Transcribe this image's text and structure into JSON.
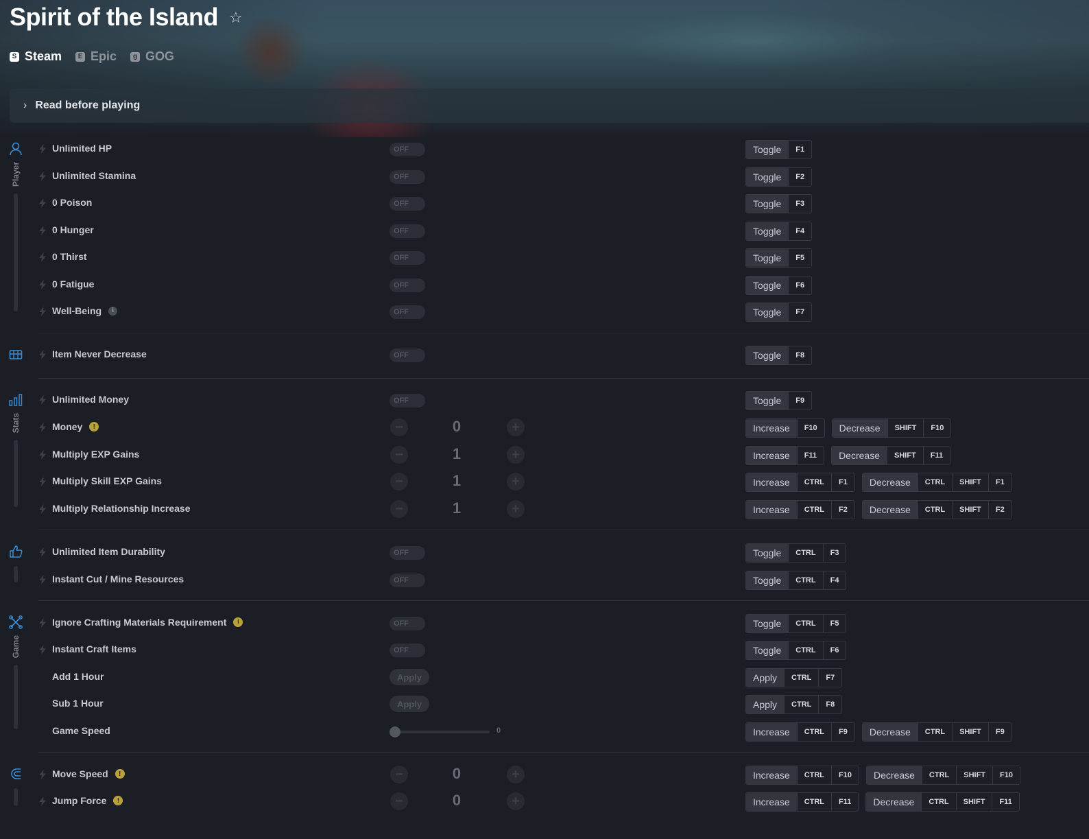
{
  "game": {
    "title": "Spirit of the Island"
  },
  "platforms": [
    {
      "label": "Steam",
      "icon": "steam-icon",
      "glyph": "S",
      "active": true
    },
    {
      "label": "Epic",
      "icon": "epic-icon",
      "glyph": "E",
      "active": false
    },
    {
      "label": "GOG",
      "icon": "gog-icon",
      "glyph": "g",
      "active": false
    }
  ],
  "notice": {
    "label": "Read before playing"
  },
  "categories": {
    "player": {
      "label": "Player",
      "icon": "person-icon"
    },
    "inventory": {
      "label": "",
      "icon": "chest-icon"
    },
    "stats": {
      "label": "Stats",
      "icon": "bar-chart-icon"
    },
    "tools": {
      "label": "",
      "icon": "thumbs-up-icon"
    },
    "game": {
      "label": "Game",
      "icon": "crossed-tools-icon"
    },
    "movement": {
      "label": "",
      "icon": "magnet-icon"
    }
  },
  "labels": {
    "off": "OFF",
    "apply": "Apply",
    "toggle": "Toggle",
    "increase": "Increase",
    "decrease": "Decrease"
  },
  "cheats": [
    {
      "name": "Unlimited HP",
      "control": "toggle",
      "state": "OFF",
      "hotkeys": [
        {
          "action": "Toggle",
          "keys": [
            "F1"
          ]
        }
      ]
    },
    {
      "name": "Unlimited Stamina",
      "control": "toggle",
      "state": "OFF",
      "hotkeys": [
        {
          "action": "Toggle",
          "keys": [
            "F2"
          ]
        }
      ]
    },
    {
      "name": "0 Poison",
      "control": "toggle",
      "state": "OFF",
      "hotkeys": [
        {
          "action": "Toggle",
          "keys": [
            "F3"
          ]
        }
      ]
    },
    {
      "name": "0 Hunger",
      "control": "toggle",
      "state": "OFF",
      "hotkeys": [
        {
          "action": "Toggle",
          "keys": [
            "F4"
          ]
        }
      ]
    },
    {
      "name": "0 Thirst",
      "control": "toggle",
      "state": "OFF",
      "hotkeys": [
        {
          "action": "Toggle",
          "keys": [
            "F5"
          ]
        }
      ]
    },
    {
      "name": "0 Fatigue",
      "control": "toggle",
      "state": "OFF",
      "hotkeys": [
        {
          "action": "Toggle",
          "keys": [
            "F6"
          ]
        }
      ]
    },
    {
      "name": "Well-Being",
      "control": "toggle",
      "state": "OFF",
      "badge": "info",
      "hotkeys": [
        {
          "action": "Toggle",
          "keys": [
            "F7"
          ]
        }
      ]
    },
    {
      "name": "Item Never Decrease",
      "control": "toggle",
      "state": "OFF",
      "hotkeys": [
        {
          "action": "Toggle",
          "keys": [
            "F8"
          ]
        }
      ]
    },
    {
      "name": "Unlimited Money",
      "control": "toggle",
      "state": "OFF",
      "hotkeys": [
        {
          "action": "Toggle",
          "keys": [
            "F9"
          ]
        }
      ]
    },
    {
      "name": "Money",
      "control": "stepper",
      "value": "0",
      "badge": "warning",
      "hotkeys": [
        {
          "action": "Increase",
          "keys": [
            "F10"
          ]
        },
        {
          "action": "Decrease",
          "keys": [
            "SHIFT",
            "F10"
          ]
        }
      ]
    },
    {
      "name": "Multiply EXP Gains",
      "control": "stepper",
      "value": "1",
      "hotkeys": [
        {
          "action": "Increase",
          "keys": [
            "F11"
          ]
        },
        {
          "action": "Decrease",
          "keys": [
            "SHIFT",
            "F11"
          ]
        }
      ]
    },
    {
      "name": "Multiply Skill EXP Gains",
      "control": "stepper",
      "value": "1",
      "hotkeys": [
        {
          "action": "Increase",
          "keys": [
            "CTRL",
            "F1"
          ]
        },
        {
          "action": "Decrease",
          "keys": [
            "CTRL",
            "SHIFT",
            "F1"
          ]
        }
      ]
    },
    {
      "name": "Multiply Relationship Increase",
      "control": "stepper",
      "value": "1",
      "hotkeys": [
        {
          "action": "Increase",
          "keys": [
            "CTRL",
            "F2"
          ]
        },
        {
          "action": "Decrease",
          "keys": [
            "CTRL",
            "SHIFT",
            "F2"
          ]
        }
      ]
    },
    {
      "name": "Unlimited Item Durability",
      "control": "toggle",
      "state": "OFF",
      "hotkeys": [
        {
          "action": "Toggle",
          "keys": [
            "CTRL",
            "F3"
          ]
        }
      ]
    },
    {
      "name": "Instant Cut / Mine Resources",
      "control": "toggle",
      "state": "OFF",
      "hotkeys": [
        {
          "action": "Toggle",
          "keys": [
            "CTRL",
            "F4"
          ]
        }
      ]
    },
    {
      "name": "Ignore Crafting Materials Requirement",
      "control": "toggle",
      "state": "OFF",
      "badge": "warning",
      "hotkeys": [
        {
          "action": "Toggle",
          "keys": [
            "CTRL",
            "F5"
          ]
        }
      ]
    },
    {
      "name": "Instant Craft Items",
      "control": "toggle",
      "state": "OFF",
      "hotkeys": [
        {
          "action": "Toggle",
          "keys": [
            "CTRL",
            "F6"
          ]
        }
      ]
    },
    {
      "name": "Add 1 Hour",
      "control": "apply",
      "bolt": false,
      "hotkeys": [
        {
          "action": "Apply",
          "keys": [
            "CTRL",
            "F7"
          ]
        }
      ]
    },
    {
      "name": "Sub 1 Hour",
      "control": "apply",
      "bolt": false,
      "hotkeys": [
        {
          "action": "Apply",
          "keys": [
            "CTRL",
            "F8"
          ]
        }
      ]
    },
    {
      "name": "Game Speed",
      "control": "slider",
      "value": "0",
      "level": 0,
      "bolt": false,
      "hotkeys": [
        {
          "action": "Increase",
          "keys": [
            "CTRL",
            "F9"
          ]
        },
        {
          "action": "Decrease",
          "keys": [
            "CTRL",
            "SHIFT",
            "F9"
          ]
        }
      ]
    },
    {
      "name": "Move Speed",
      "control": "stepper",
      "value": "0",
      "badge": "warning",
      "hotkeys": [
        {
          "action": "Increase",
          "keys": [
            "CTRL",
            "F10"
          ]
        },
        {
          "action": "Decrease",
          "keys": [
            "CTRL",
            "SHIFT",
            "F10"
          ]
        }
      ]
    },
    {
      "name": "Jump Force",
      "control": "stepper",
      "value": "0",
      "badge": "warning",
      "hotkeys": [
        {
          "action": "Increase",
          "keys": [
            "CTRL",
            "F11"
          ]
        },
        {
          "action": "Decrease",
          "keys": [
            "CTRL",
            "SHIFT",
            "F11"
          ]
        }
      ]
    }
  ],
  "colors": {
    "accent": "#3a8fd9",
    "warning": "#b9a23a",
    "background": "#1c1e25"
  }
}
